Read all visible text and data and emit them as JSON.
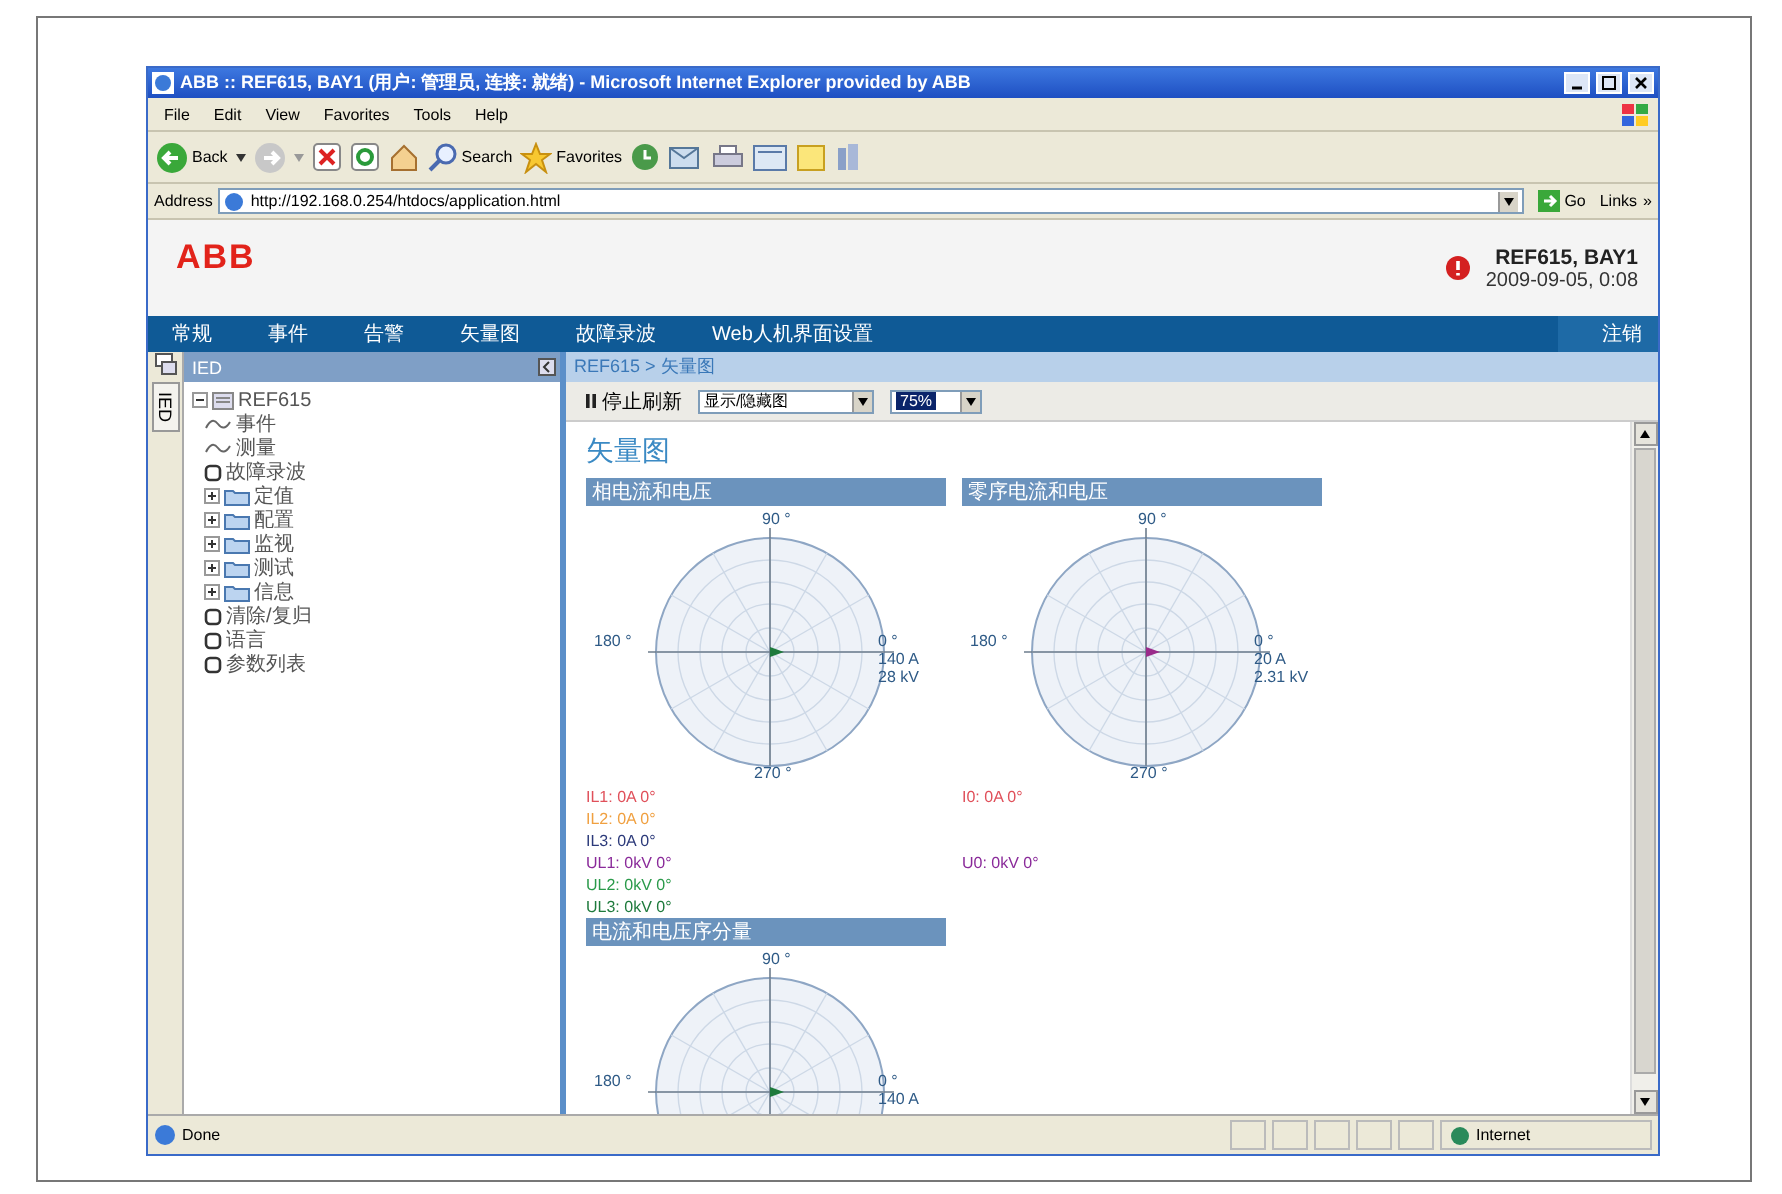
{
  "window": {
    "title": "ABB :: REF615, BAY1 (用户: 管理员, 连接: 就绪) - Microsoft Internet Explorer provided by ABB"
  },
  "menu": [
    "File",
    "Edit",
    "View",
    "Favorites",
    "Tools",
    "Help"
  ],
  "toolbar": {
    "back": "Back",
    "search": "Search",
    "favorites": "Favorites"
  },
  "address": {
    "label": "Address",
    "url": "http://192.168.0.254/htdocs/application.html",
    "go": "Go",
    "links": "Links",
    "chevron": "»"
  },
  "header": {
    "logo": "ABB",
    "device": "REF615, BAY1",
    "datetime": "2009-09-05, 0:08"
  },
  "nav": {
    "items": [
      "常规",
      "事件",
      "告警",
      "矢量图",
      "故障录波",
      "Web人机界面设置"
    ],
    "logout": "注销"
  },
  "sidebar": {
    "tab": "IED",
    "title": "IED",
    "tree": [
      {
        "label": "REF615",
        "kind": "root",
        "expanded": true,
        "children": [
          {
            "label": "事件",
            "kind": "wave"
          },
          {
            "label": "测量",
            "kind": "wave"
          },
          {
            "label": "故障录波",
            "kind": "page"
          },
          {
            "label": "定值",
            "kind": "folder",
            "expanded": false
          },
          {
            "label": "配置",
            "kind": "folder",
            "expanded": false
          },
          {
            "label": "监视",
            "kind": "folder",
            "expanded": false
          },
          {
            "label": "测试",
            "kind": "folder",
            "expanded": false
          },
          {
            "label": "信息",
            "kind": "folder",
            "expanded": false
          },
          {
            "label": "清除/复归",
            "kind": "page"
          },
          {
            "label": "语言",
            "kind": "page"
          },
          {
            "label": "参数列表",
            "kind": "page"
          }
        ]
      }
    ]
  },
  "breadcrumb": "REF615 > 矢量图",
  "controls": {
    "pause": "停止刷新",
    "view_select": "显示/隐藏图",
    "zoom_select": "75%"
  },
  "page_title": "矢量图",
  "panels": [
    {
      "title": "相电流和电压",
      "color": "#1e7a3c",
      "angles": {
        "top": "90 °",
        "left": "180 °",
        "right": "0 °",
        "bottom": "270 °"
      },
      "readings": [
        "140 A",
        "28 kV"
      ],
      "currents": [
        {
          "text": "IL1: 0A 0°",
          "color": "#e0505a"
        },
        {
          "text": "IL2: 0A 0°",
          "color": "#f0a040"
        },
        {
          "text": "IL3: 0A 0°",
          "color": "#2c3a7a"
        }
      ],
      "voltages": [
        {
          "text": "UL1: 0kV 0°",
          "color": "#8a2a9a"
        },
        {
          "text": "UL2: 0kV 0°",
          "color": "#2a9a4a"
        },
        {
          "text": "UL3: 0kV 0°",
          "color": "#1e7a3c"
        }
      ]
    },
    {
      "title": "零序电流和电压",
      "color": "#9a2a8a",
      "angles": {
        "top": "90 °",
        "left": "180 °",
        "right": "0 °",
        "bottom": "270 °"
      },
      "readings": [
        "20 A",
        "2.31 kV"
      ],
      "currents": [
        {
          "text": "I0: 0A 0°",
          "color": "#e0505a"
        }
      ],
      "voltages": [
        {
          "text": "U0: 0kV 0°",
          "color": "#8a2a9a"
        }
      ]
    },
    {
      "title": "电流和电压序分量",
      "color": "#1e7a3c",
      "angles": {
        "top": "90 °",
        "left": "180 °",
        "right": "0 °"
      },
      "readings": [
        "140 A"
      ]
    }
  ],
  "status": {
    "text": "Done",
    "zone": "Internet"
  }
}
